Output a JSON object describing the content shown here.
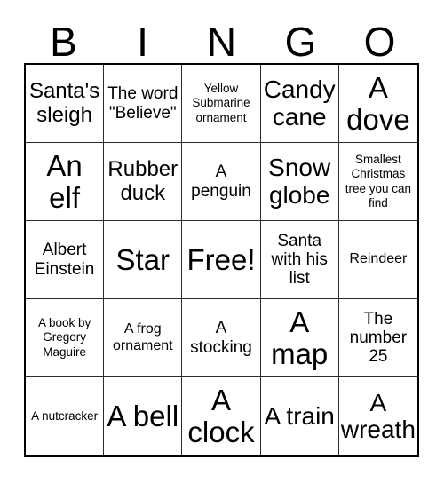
{
  "card": {
    "header_letters": [
      "B",
      "I",
      "N",
      "G",
      "O"
    ],
    "rows": [
      [
        {
          "text": "Santa's sleigh",
          "size": "lg"
        },
        {
          "text": "The word \"Believe\"",
          "size": "md"
        },
        {
          "text": "Yellow Submarine ornament",
          "size": "xs"
        },
        {
          "text": "Candy cane",
          "size": "xl"
        },
        {
          "text": "A dove",
          "size": "xxl"
        }
      ],
      [
        {
          "text": "An elf",
          "size": "xxl"
        },
        {
          "text": "Rubber duck",
          "size": "lg"
        },
        {
          "text": "A penguin",
          "size": "md"
        },
        {
          "text": "Snow globe",
          "size": "xl"
        },
        {
          "text": "Smallest Christmas tree you can find",
          "size": "xs"
        }
      ],
      [
        {
          "text": "Albert Einstein",
          "size": "md"
        },
        {
          "text": "Star",
          "size": "xxl"
        },
        {
          "text": "Free!",
          "size": "xxl"
        },
        {
          "text": "Santa with his list",
          "size": "md"
        },
        {
          "text": "Reindeer",
          "size": "sm"
        }
      ],
      [
        {
          "text": "A book by Gregory Maguire",
          "size": "xs"
        },
        {
          "text": "A frog ornament",
          "size": "sm"
        },
        {
          "text": "A stocking",
          "size": "md"
        },
        {
          "text": "A map",
          "size": "xxl"
        },
        {
          "text": "The number 25",
          "size": "md"
        }
      ],
      [
        {
          "text": "A nutcracker",
          "size": "xs"
        },
        {
          "text": "A bell",
          "size": "xxl"
        },
        {
          "text": "A clock",
          "size": "xxl"
        },
        {
          "text": "A train",
          "size": "xl"
        },
        {
          "text": "A wreath",
          "size": "xl"
        }
      ]
    ]
  },
  "colors": {
    "background": "#ffffff",
    "text": "#000000",
    "grid_outer_border": "#000000",
    "grid_inner_border": "#2b2b2b"
  }
}
